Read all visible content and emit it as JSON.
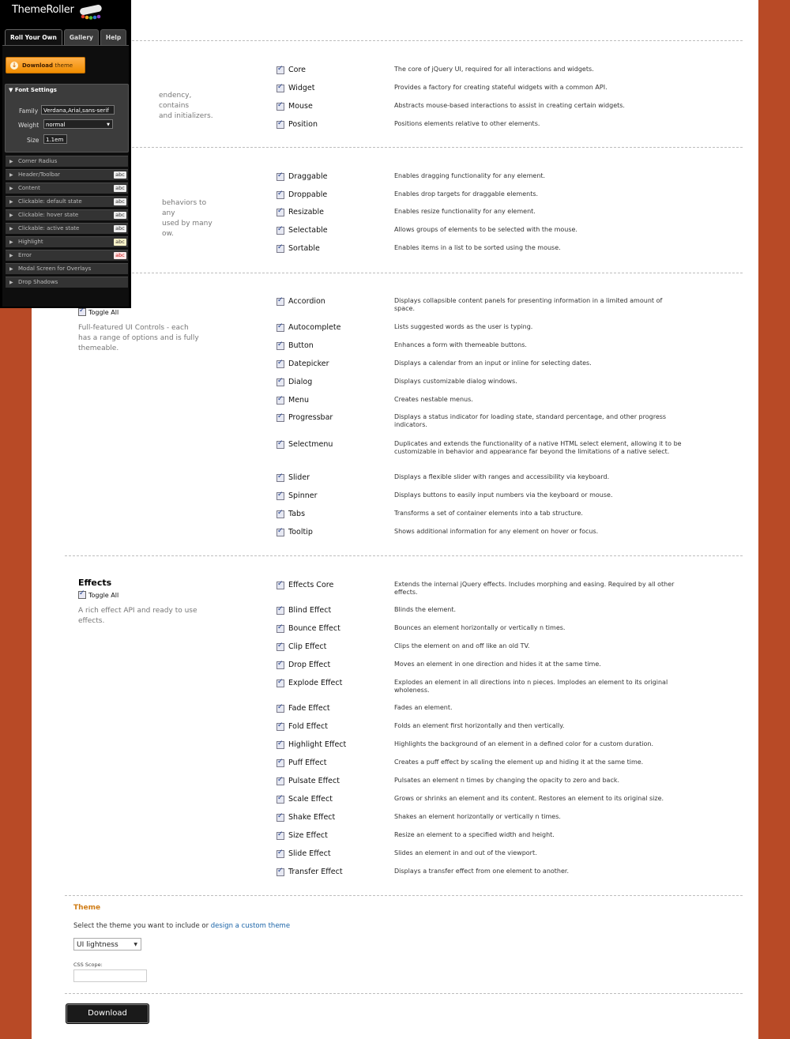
{
  "themeroller": {
    "title": "ThemeRoller",
    "tabs": [
      "Roll Your Own",
      "Gallery",
      "Help"
    ],
    "download_theme_label": "Download",
    "download_theme_sub": "theme",
    "font_settings": {
      "heading": "Font Settings",
      "family_label": "Family",
      "family_value": "Verdana,Arial,sans-serif",
      "weight_label": "Weight",
      "weight_value": "normal",
      "size_label": "Size",
      "size_value": "1.1em"
    },
    "items": [
      {
        "label": "Corner Radius",
        "badge": ""
      },
      {
        "label": "Header/Toolbar",
        "badge": "abc"
      },
      {
        "label": "Content",
        "badge": "abc"
      },
      {
        "label": "Clickable: default state",
        "badge": "abc"
      },
      {
        "label": "Clickable: hover state",
        "badge": "abc"
      },
      {
        "label": "Clickable: active state",
        "badge": "abc"
      },
      {
        "label": "Highlight",
        "badge": "abc"
      },
      {
        "label": "Error",
        "badge": "abc"
      },
      {
        "label": "Modal Screen for Overlays",
        "badge": ""
      },
      {
        "label": "Drop Shadows",
        "badge": ""
      }
    ],
    "colors": {
      "highlight_badge": "#fbf3c9",
      "error_badge": "#fde9e9",
      "error_text": "#cd0a0a"
    }
  },
  "sections": [
    {
      "title": "",
      "desc_lines": [
        "endency, contains",
        "and initializers."
      ],
      "components": [
        {
          "name": "Core",
          "desc": "The core of jQuery UI, required for all interactions and widgets."
        },
        {
          "name": "Widget",
          "desc": "Provides a factory for creating stateful widgets with a common API."
        },
        {
          "name": "Mouse",
          "desc": "Abstracts mouse-based interactions to assist in creating certain widgets."
        },
        {
          "name": "Position",
          "desc": "Positions elements relative to other elements."
        }
      ]
    },
    {
      "title": "",
      "desc_lines": [
        "behaviors to any",
        "used by many",
        "ow."
      ],
      "components": [
        {
          "name": "Draggable",
          "desc": "Enables dragging functionality for any element."
        },
        {
          "name": "Droppable",
          "desc": "Enables drop targets for draggable elements."
        },
        {
          "name": "Resizable",
          "desc": "Enables resize functionality for any element."
        },
        {
          "name": "Selectable",
          "desc": "Allows groups of elements to be selected with the mouse."
        },
        {
          "name": "Sortable",
          "desc": "Enables items in a list to be sorted using the mouse."
        }
      ]
    },
    {
      "title": "",
      "toggle_label": "Toggle All",
      "desc_lines": [
        "Full-featured UI Controls - each",
        "has a range of options and is fully",
        "themeable."
      ],
      "components": [
        {
          "name": "Accordion",
          "desc": "Displays collapsible content panels for presenting information in a limited amount of space."
        },
        {
          "name": "Autocomplete",
          "desc": "Lists suggested words as the user is typing."
        },
        {
          "name": "Button",
          "desc": "Enhances a form with themeable buttons."
        },
        {
          "name": "Datepicker",
          "desc": "Displays a calendar from an input or inline for selecting dates."
        },
        {
          "name": "Dialog",
          "desc": "Displays customizable dialog windows."
        },
        {
          "name": "Menu",
          "desc": "Creates nestable menus."
        },
        {
          "name": "Progressbar",
          "desc": "Displays a status indicator for loading state, standard percentage, and other progress indicators."
        },
        {
          "name": "Selectmenu",
          "desc": "Duplicates and extends the functionality of a native HTML select element, allowing it to be customizable in behavior and appearance far beyond the limitations of a native select."
        },
        {
          "name": "Slider",
          "desc": "Displays a flexible slider with ranges and accessibility via keyboard."
        },
        {
          "name": "Spinner",
          "desc": "Displays buttons to easily input numbers via the keyboard or mouse."
        },
        {
          "name": "Tabs",
          "desc": "Transforms a set of container elements into a tab structure."
        },
        {
          "name": "Tooltip",
          "desc": "Shows additional information for any element on hover or focus."
        }
      ]
    },
    {
      "title": "Effects",
      "toggle_label": "Toggle All",
      "desc_lines": [
        "A rich effect API and ready to use",
        "effects."
      ],
      "components": [
        {
          "name": "Effects Core",
          "desc": "Extends the internal jQuery effects. Includes morphing and easing. Required by all other effects."
        },
        {
          "name": "Blind Effect",
          "desc": "Blinds the element."
        },
        {
          "name": "Bounce Effect",
          "desc": "Bounces an element horizontally or vertically n times."
        },
        {
          "name": "Clip Effect",
          "desc": "Clips the element on and off like an old TV."
        },
        {
          "name": "Drop Effect",
          "desc": "Moves an element in one direction and hides it at the same time."
        },
        {
          "name": "Explode Effect",
          "desc": "Explodes an element in all directions into n pieces. Implodes an element to its original wholeness."
        },
        {
          "name": "Fade Effect",
          "desc": "Fades an element."
        },
        {
          "name": "Fold Effect",
          "desc": "Folds an element first horizontally and then vertically."
        },
        {
          "name": "Highlight Effect",
          "desc": "Highlights the background of an element in a defined color for a custom duration."
        },
        {
          "name": "Puff Effect",
          "desc": "Creates a puff effect by scaling the element up and hiding it at the same time."
        },
        {
          "name": "Pulsate Effect",
          "desc": "Pulsates an element n times by changing the opacity to zero and back."
        },
        {
          "name": "Scale Effect",
          "desc": "Grows or shrinks an element and its content. Restores an element to its original size."
        },
        {
          "name": "Shake Effect",
          "desc": "Shakes an element horizontally or vertically n times."
        },
        {
          "name": "Size Effect",
          "desc": "Resize an element to a specified width and height."
        },
        {
          "name": "Slide Effect",
          "desc": "Slides an element in and out of the viewport."
        },
        {
          "name": "Transfer Effect",
          "desc": "Displays a transfer effect from one element to another."
        }
      ]
    }
  ],
  "theme": {
    "title": "Theme",
    "prompt": "Select the theme you want to include or",
    "link": "design a custom theme",
    "selected": "UI lightness",
    "scope_label": "CSS Scope:",
    "scope_value": ""
  },
  "download_label": "Download",
  "colors": {
    "background": "#b84a26",
    "theme_title": "#d07d17",
    "link": "#1a64a8",
    "download_theme_btn": "#f59a1e"
  }
}
